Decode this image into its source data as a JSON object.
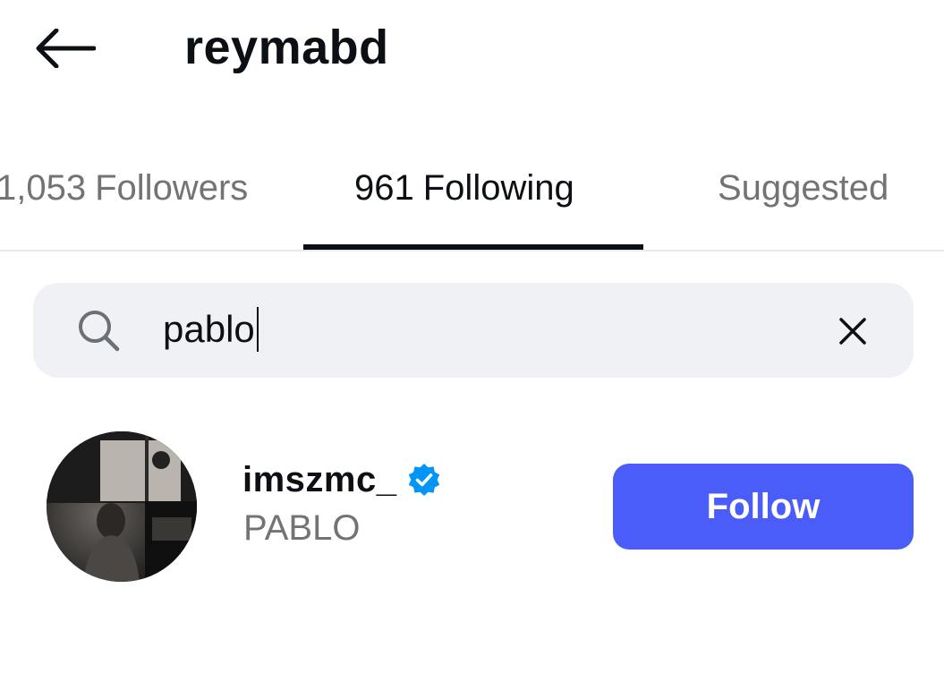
{
  "header": {
    "back_icon": "arrow-left-icon",
    "title": "reymabd"
  },
  "tabs": [
    {
      "count": "1,053",
      "label": "Followers",
      "active": false
    },
    {
      "count": "961",
      "label": "Following",
      "active": true
    },
    {
      "count": "",
      "label": "Suggested",
      "active": false
    }
  ],
  "search": {
    "icon": "search-icon",
    "value": "pablo",
    "clear_icon": "close-icon"
  },
  "results": [
    {
      "username": "imszmc_",
      "verified": true,
      "full_name": "PABLO",
      "action_label": "Follow"
    }
  ],
  "colors": {
    "accent": "#4a5df9",
    "verified": "#0095f6",
    "text_primary": "#0c1014",
    "text_secondary": "#737373",
    "search_bg": "#eff1f5"
  }
}
